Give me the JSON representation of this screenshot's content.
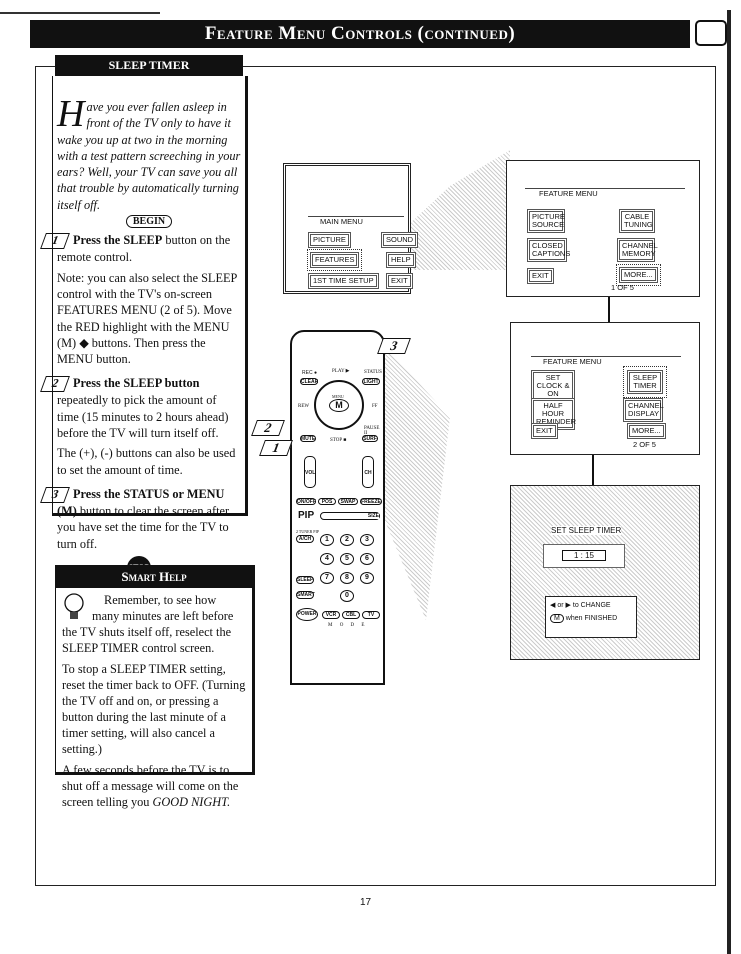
{
  "header": {
    "title": "Feature Menu Controls (continued)"
  },
  "section": {
    "title": "SLEEP TIMER",
    "intro_dropcap": "H",
    "intro": "ave you ever fallen asleep in front of the TV only to have it wake you up at two in the morning with a test pattern screeching in your ears? Well, your TV can save you all that trouble by automatically turning itself off.",
    "begin": "BEGIN",
    "steps": [
      {
        "num": "1",
        "bold": "Press the SLEEP",
        "text": " button on the remote control.",
        "note": "Note: you can also select the SLEEP control with the TV's on-screen FEATURES MENU (2 of 5). Move the RED highlight with the MENU (M) ◆ buttons. Then press the MENU button."
      },
      {
        "num": "2",
        "bold": "Press the SLEEP button",
        "text": " repeatedly to pick the amount of time (15 minutes to 2 hours ahead) before the TV will turn itself off.",
        "note": "The (+), (-) buttons can also be used to set the amount of time."
      },
      {
        "num": "3",
        "bold": "Press the STATUS or MENU (M)",
        "text": " button to clear the screen after you have set the time for the TV to turn off."
      }
    ],
    "stop": "STOP"
  },
  "smart_help": {
    "title": "Smart Help",
    "p1": "Remember, to see how many minutes are left before the TV shuts itself off, reselect the SLEEP TIMER control screen.",
    "p2": "To stop a SLEEP TIMER setting, reset the timer back to OFF. (Turning the TV off and on, or pressing a button during the last minute of a timer setting, will also cancel a setting.)",
    "p3_pre": "A few seconds before the TV is to shut off a message will come on the screen telling you ",
    "p3_em": "GOOD NIGHT."
  },
  "main_menu": {
    "title": "MAIN MENU",
    "items": [
      "PICTURE",
      "SOUND",
      "FEATURES",
      "HELP",
      "1ST TIME SETUP",
      "EXIT"
    ],
    "highlight": "FEATURES"
  },
  "feature_menu_1": {
    "title": "FEATURE MENU",
    "items": [
      "PICTURE SOURCE",
      "CABLE TUNING",
      "CLOSED CAPTIONS",
      "CHANNEL MEMORY",
      "EXIT",
      "MORE..."
    ],
    "page": "1 OF 5",
    "highlight": "MORE..."
  },
  "feature_menu_2": {
    "title": "FEATURE MENU",
    "items": [
      "SET CLOCK & ON TIMER",
      "SLEEP TIMER",
      "HALF HOUR REMINDER",
      "CHANNEL DISPLAY",
      "EXIT",
      "MORE..."
    ],
    "page": "2 OF 5",
    "highlight": "SLEEP TIMER"
  },
  "sleep_screen": {
    "title": "SET SLEEP TIMER",
    "value": "1 : 15",
    "change": "to CHANGE",
    "or": "or",
    "finished": "when FINISHED",
    "m": "M"
  },
  "remote": {
    "labels": [
      "REC ●",
      "CLEAR",
      "PLAY ▶",
      "STATUS",
      "LIGHT",
      "REW",
      "FF",
      "MENU",
      "M",
      "MUTE",
      "STOP ■",
      "PAUSE II",
      "SURF",
      "VOL",
      "CH",
      "ON/OFF",
      "POS",
      "SWAP",
      "FREEZE",
      "PIP",
      "SIZE",
      "2 TUNER PIP",
      "A/CH",
      "SLEEP",
      "SMART",
      "POWER",
      "VCR",
      "CBL",
      "TV",
      "M O D E"
    ],
    "numbers": [
      "1",
      "2",
      "3",
      "4",
      "5",
      "6",
      "7",
      "8",
      "9",
      "0"
    ],
    "callouts": [
      "1",
      "2",
      "3"
    ]
  },
  "page_number": "17"
}
